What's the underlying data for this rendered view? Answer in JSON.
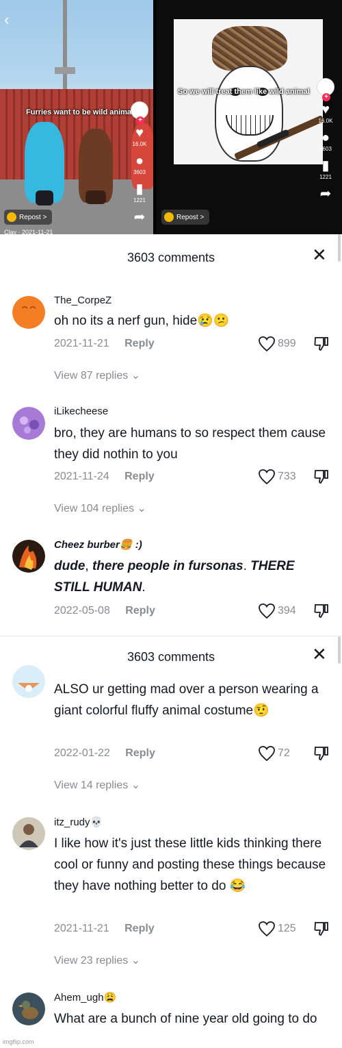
{
  "video_strip": {
    "left_video": {
      "caption": "Furries want to be wild animals",
      "repost_label": "Repost >",
      "author_partial": "Clay · 2021-11-21",
      "rail": [
        {
          "icon": "heart-icon",
          "count": "16.0K"
        },
        {
          "icon": "comment-icon",
          "count": "3603"
        },
        {
          "icon": "bookmark-icon",
          "count": "1221"
        },
        {
          "icon": "share-icon",
          "count": ""
        }
      ]
    },
    "right_video": {
      "caption": "So we will treat them like wild animal",
      "repost_label": "Repost >",
      "rail": [
        {
          "icon": "heart-icon",
          "count": "16.0K"
        },
        {
          "icon": "comment-icon",
          "count": "3603"
        },
        {
          "icon": "bookmark-icon",
          "count": "1221"
        },
        {
          "icon": "share-icon",
          "count": ""
        }
      ]
    }
  },
  "panels": [
    {
      "title": "3603 comments",
      "comments": [
        {
          "user": "The_CorpeZ",
          "text": "oh no its a nerf gun, hide😢😕",
          "date": "2021-11-21",
          "reply": "Reply",
          "likes": "899",
          "view_replies": "View 87 replies ⌄"
        },
        {
          "user": "iLikecheese",
          "text": "bro, they are humans to so respect them cause they did nothin to you",
          "date": "2021-11-24",
          "reply": "Reply",
          "likes": "733",
          "view_replies": "View 104 replies ⌄"
        },
        {
          "user": "Cheez burber🍔 :)",
          "text_parts": [
            "dude",
            ", ",
            "there people in fursonas",
            ". ",
            "THERE STILL HUMAN",
            "."
          ],
          "date": "2022-05-08",
          "reply": "Reply",
          "likes": "394"
        }
      ]
    },
    {
      "title": "3603 comments",
      "comments": [
        {
          "user": "",
          "text": "ALSO ur getting mad over a person wearing a giant colorful fluffy animal costume🤨",
          "date": "2022-01-22",
          "reply": "Reply",
          "likes": "72",
          "view_replies": "View 14 replies ⌄"
        },
        {
          "user": "itz_rudy💀",
          "text": "I like how it's just these little kids thinking there cool or funny and posting these things because they have nothing better to do 😂",
          "date": "2021-11-21",
          "reply": "Reply",
          "likes": "125",
          "view_replies": "View 23 replies ⌄"
        },
        {
          "user": "Ahem_ugh😩",
          "text": "What are a bunch of nine year old going to do"
        }
      ]
    }
  ],
  "watermark": "imgflip.com",
  "colors": {
    "text": "#161823",
    "muted": "#8a8b91",
    "accent": "#fe2c55"
  }
}
